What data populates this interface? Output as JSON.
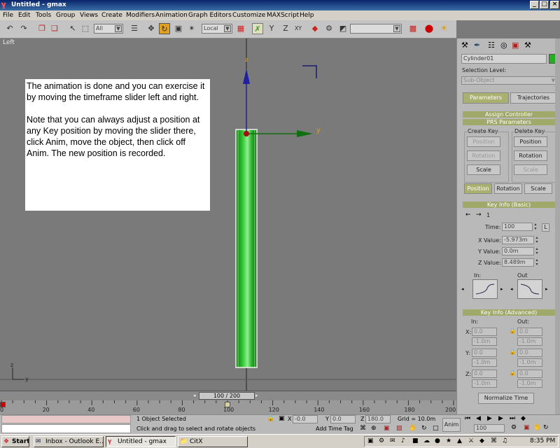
{
  "window": {
    "title": "Untitled - gmax",
    "min": "_",
    "max": "□",
    "close": "×"
  },
  "menu": [
    "File",
    "Edit",
    "Tools",
    "Group",
    "Views",
    "Create",
    "Modifiers",
    "Animation",
    "Graph Editors",
    "Customize",
    "MAXScript",
    "Help"
  ],
  "toolbar": {
    "selection_filter": "All",
    "coord_system": "Local",
    "named_selection": ""
  },
  "viewport": {
    "label": "Left",
    "axis_labels": {
      "z": "z",
      "y": "y",
      "x": "x"
    },
    "note": {
      "para1": "The animation is done and you can exercise it by moving the timeframe slider left and right.",
      "para2": "Note that you can always adjust a position at any Key position by moving the slider there, click Anim, move the object, then click off Anim. The new position is recorded."
    }
  },
  "command_panel": {
    "object_name": "Cylinder01",
    "selection_level_label": "Selection Level:",
    "sub_object": "Sub-Object",
    "tabs": [
      "Parameters",
      "Trajectories"
    ],
    "assign_controller": "Assign Controller",
    "prs_parameters": "PRS Parameters",
    "create_key": "Create Key",
    "delete_key": "Delete Key",
    "create_buttons": [
      "Position",
      "Rotation",
      "Scale"
    ],
    "delete_buttons": [
      "Position",
      "Rotation",
      "Scale"
    ],
    "prs_tabs": [
      "Position",
      "Rotation",
      "Scale"
    ],
    "key_info_basic": "Key Info (Basic)",
    "key_index": "1",
    "time_label": "Time:",
    "time_value": "100",
    "lock": "L",
    "x_label": "X Value:",
    "x_value": "-5.973m",
    "y_label": "Y Value:",
    "y_value": "0.0m",
    "z_label": "Z Value:",
    "z_value": "8.489m",
    "in_label": "In:",
    "out_label": "Out",
    "key_info_adv": "Key Info (Advanced)",
    "adv_in": "In:",
    "adv_out": "Out:",
    "adv_rows": [
      {
        "axis": "X:",
        "in": "0.0",
        "in2": "-1.0m",
        "out": "0.0",
        "out2": "-1.0m"
      },
      {
        "axis": "Y:",
        "in": "0.0",
        "in2": "-1.0m",
        "out": "0.0",
        "out2": "-1.0m"
      },
      {
        "axis": "Z:",
        "in": "0.0",
        "in2": "-1.0m",
        "out": "0.0",
        "out2": "-1.0m"
      }
    ],
    "normalize_time": "Normalize Time"
  },
  "timeline": {
    "slider": "100 / 200",
    "ticks": [
      "0",
      "20",
      "40",
      "60",
      "80",
      "100",
      "120",
      "140",
      "160",
      "180",
      "200"
    ],
    "position": 100,
    "range": 200
  },
  "status": {
    "selected": "1 Object Selected",
    "prompt": "Click and drag to select and rotate objects",
    "x": "-0.0",
    "y": "0.0",
    "z": "180.0",
    "grid": "Grid = 10.0m",
    "add_time_tag": "Add Time Tag",
    "anim": "Anim",
    "frame": "100"
  },
  "taskbar": {
    "start": "Start",
    "tasks": [
      "Inbox - Outlook E...",
      "Untitled - gmax",
      "CitX"
    ],
    "clock": "8:35 PM"
  },
  "colors": {
    "object": "#22b022",
    "accent": "#aab070",
    "titlebar": "#0a246a"
  }
}
